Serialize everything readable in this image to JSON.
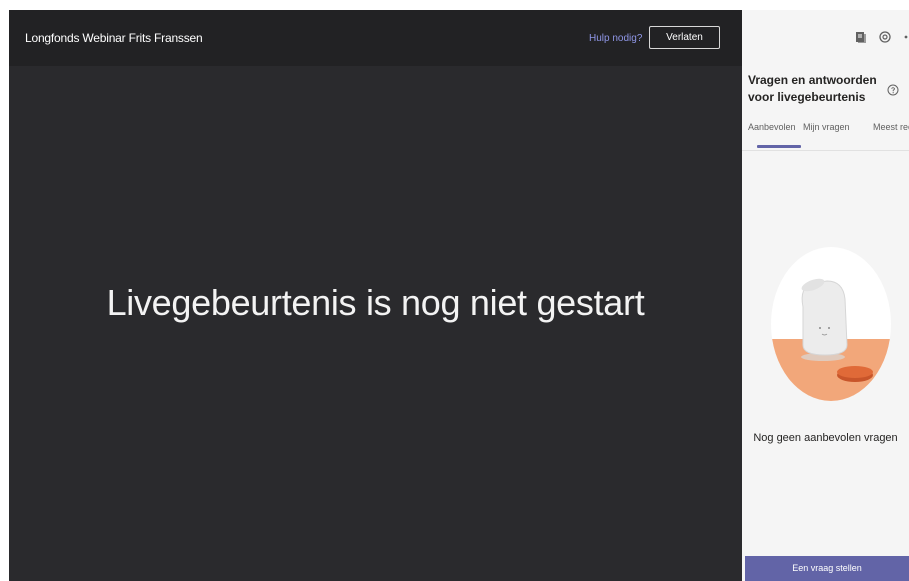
{
  "header": {
    "event_title": "Longfonds Webinar Frits Franssen",
    "help_link": "Hulp nodig?",
    "leave_button": "Verlaten"
  },
  "stage": {
    "status_message": "Livegebeurtenis is nog niet gestart"
  },
  "panel": {
    "title": "Vragen en antwoorden voor livegebeurtenis",
    "tabs": [
      {
        "label": "Aanbevolen",
        "active": true
      },
      {
        "label": "Mijn vragen",
        "active": false
      },
      {
        "label": "Meest rec",
        "active": false
      }
    ],
    "empty_state": "Nog geen aanbevolen vragen",
    "ask_button": "Een vraag stellen",
    "icons": [
      "notes-icon",
      "settings-icon",
      "more-icon",
      "help-icon"
    ]
  },
  "colors": {
    "stage_bg": "#2a2a2d",
    "header_bg": "#222224",
    "panel_bg": "#f5f5f5",
    "accent": "#6264a7",
    "link": "#8f96e6",
    "illustration_orange": "#f2a77a"
  }
}
